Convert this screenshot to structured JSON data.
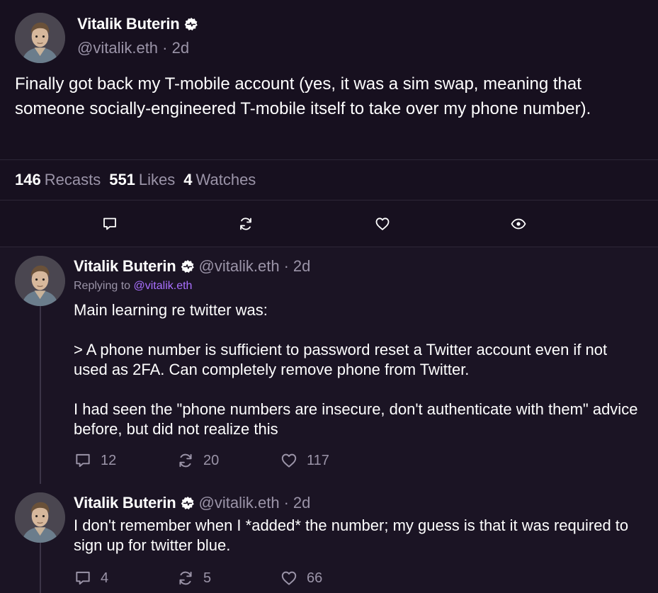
{
  "colors": {
    "background": "#17101f",
    "reply_background": "#1b1424",
    "muted_text": "#9b94a8",
    "mention": "#a970ff",
    "divider": "#2d2738"
  },
  "main_cast": {
    "author_name": "Vitalik Buterin",
    "handle": "@vitalik.eth",
    "time": "2d",
    "separator": "·",
    "text": "Finally got back my T-mobile account (yes, it was a sim swap, meaning that someone socially-engineered T-mobile itself to take over my phone number)."
  },
  "stats": [
    {
      "count": "146",
      "label": "Recasts"
    },
    {
      "count": "551",
      "label": "Likes"
    },
    {
      "count": "4",
      "label": "Watches"
    }
  ],
  "actions": [
    {
      "icon": "comment-icon"
    },
    {
      "icon": "recast-icon"
    },
    {
      "icon": "heart-icon"
    },
    {
      "icon": "eye-icon"
    }
  ],
  "replies": [
    {
      "author_name": "Vitalik Buterin",
      "handle": "@vitalik.eth",
      "separator": "·",
      "time": "2d",
      "replying_to_label": "Replying to",
      "replying_to_handle": "@vitalik.eth",
      "text": "Main learning re twitter was:\n\n> A phone number is sufficient to password reset a Twitter account even if not used as 2FA. Can completely remove phone from Twitter.\n\nI had seen the \"phone numbers are insecure, don't authenticate with them\" advice before, but did not realize this",
      "comments": "12",
      "recasts": "20",
      "likes": "117"
    },
    {
      "author_name": "Vitalik Buterin",
      "handle": "@vitalik.eth",
      "separator": "·",
      "time": "2d",
      "text": "I don't remember when I *added* the number; my guess is that it was required to sign up for twitter blue.",
      "comments": "4",
      "recasts": "5",
      "likes": "66"
    }
  ]
}
